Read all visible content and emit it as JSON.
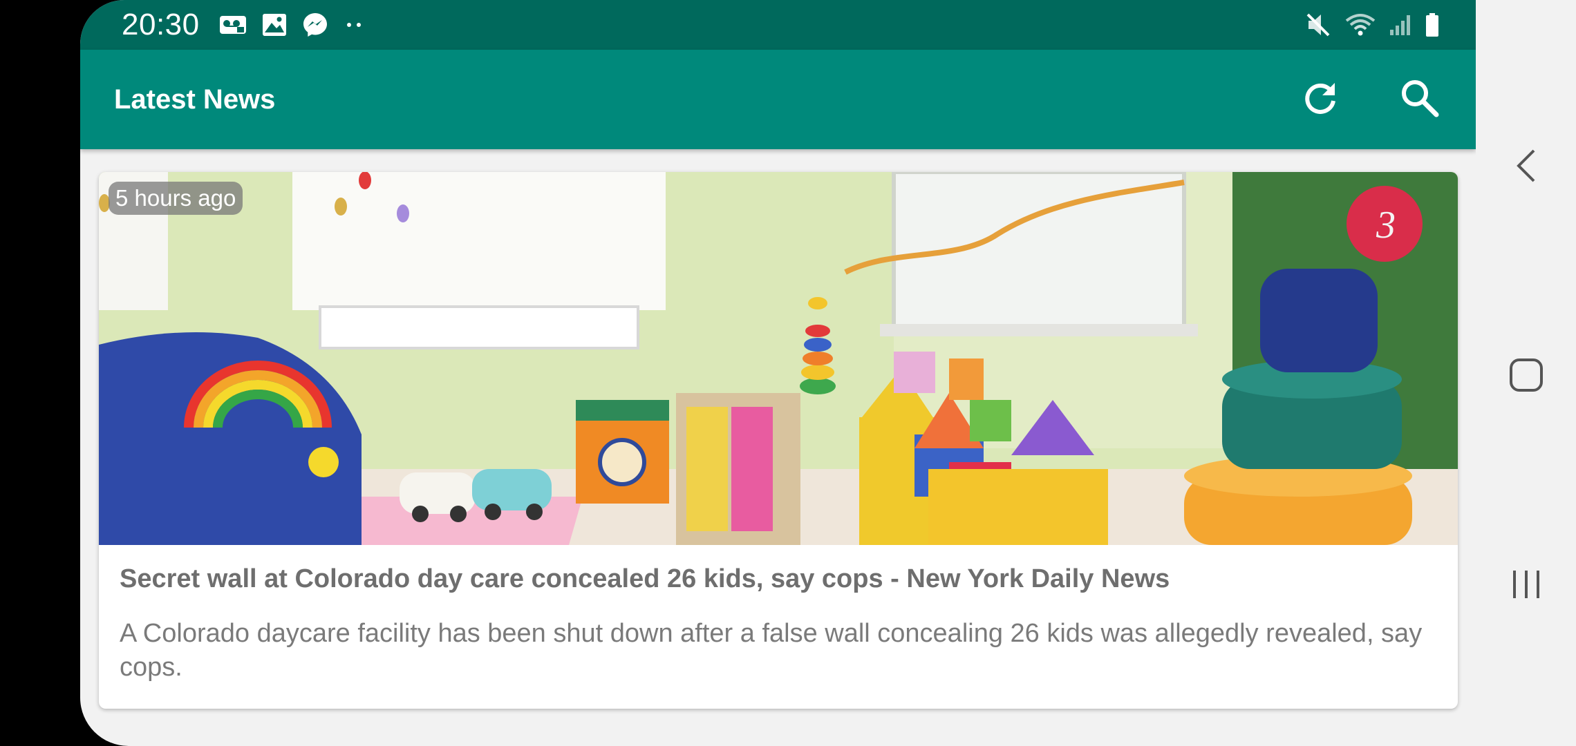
{
  "status_bar": {
    "time": "20:30",
    "left_icons": [
      "voicemail-icon",
      "image-icon",
      "messenger-icon",
      "more-dots-icon"
    ],
    "right_icons": [
      "mute-icon",
      "wifi-icon",
      "signal-icon",
      "battery-icon"
    ]
  },
  "app_bar": {
    "title": "Latest News",
    "actions": [
      "refresh-icon",
      "search-icon"
    ]
  },
  "articles": [
    {
      "time_ago": "5 hours ago",
      "title": "Secret wall at Colorado day care concealed 26 kids, say cops - New York Daily News",
      "description": "A Colorado daycare facility has been shut down after a false wall concealing 26 kids was allegedly revealed, say cops.",
      "image_description": "playroom with colorful toys and foam blocks",
      "image_number": "3"
    }
  ],
  "nav_bar": {
    "buttons": [
      "back-icon",
      "home-icon",
      "recents-icon"
    ]
  },
  "colors": {
    "status_bar": "#00695c",
    "app_bar": "#00897b",
    "background": "#f2f2f2"
  }
}
